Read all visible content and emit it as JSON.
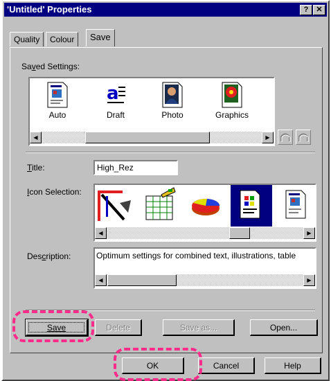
{
  "window": {
    "title": "'Untitled' Properties",
    "help_btn": "?",
    "close_btn": "✕"
  },
  "tabs": [
    {
      "label": "Quality"
    },
    {
      "label": "Colour"
    },
    {
      "label": "Save"
    }
  ],
  "saved_settings": {
    "label": "Saved Settings:",
    "items": [
      {
        "label": "Auto",
        "icon": "auto-document-icon"
      },
      {
        "label": "Draft",
        "icon": "draft-text-icon"
      },
      {
        "label": "Photo",
        "icon": "photo-portrait-icon"
      },
      {
        "label": "Graphics",
        "icon": "graphics-flower-icon"
      }
    ]
  },
  "title_field": {
    "label": "Title:",
    "value": "High_Rez"
  },
  "icon_selection": {
    "label": "Icon Selection:",
    "icons": [
      "drafting-tools-icon",
      "spreadsheet-icon",
      "pie-chart-icon",
      "document-icon",
      "auto-document-icon"
    ],
    "selected_index": 3
  },
  "description": {
    "label": "Description:",
    "value": "Optimum settings for combined text, illustrations, table"
  },
  "buttons": {
    "save": "Save",
    "delete": "Delete",
    "save_as": "Save as...",
    "open": "Open...",
    "ok": "OK",
    "cancel": "Cancel",
    "help": "Help"
  },
  "colors": {
    "titlebar": "#000080",
    "face": "#c0c0c0",
    "highlight_annotation": "#ff2b8a"
  }
}
